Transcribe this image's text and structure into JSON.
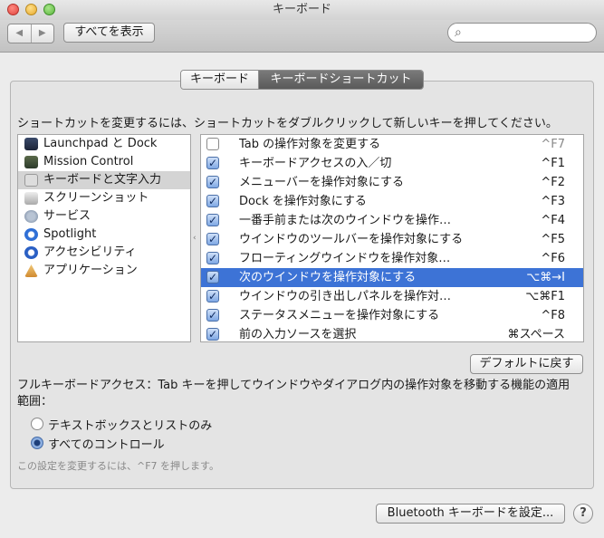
{
  "window": {
    "title": "キーボード"
  },
  "toolbar": {
    "back": "◀",
    "forward": "▶",
    "show_all": "すべてを表示",
    "search_icon": "🔍"
  },
  "tabs": [
    {
      "label": "キーボード",
      "selected": false
    },
    {
      "label": "キーボードショートカット",
      "selected": true
    }
  ],
  "instruction": "ショートカットを変更するには、ショートカットをダブルクリックして新しいキーを押してください。",
  "categories": [
    {
      "label": "Launchpad と Dock",
      "icon": "launchpad-dock-icon",
      "selected": false
    },
    {
      "label": "Mission Control",
      "icon": "mission-control-icon",
      "selected": false
    },
    {
      "label": "キーボードと文字入力",
      "icon": "keyboard-icon",
      "selected": true
    },
    {
      "label": "スクリーンショット",
      "icon": "screenshot-icon",
      "selected": false
    },
    {
      "label": "サービス",
      "icon": "gear-icon",
      "selected": false
    },
    {
      "label": "Spotlight",
      "icon": "spotlight-icon",
      "selected": false
    },
    {
      "label": "アクセシビリティ",
      "icon": "accessibility-icon",
      "selected": false
    },
    {
      "label": "アプリケーション",
      "icon": "app-store-icon",
      "selected": false
    }
  ],
  "shortcuts": [
    {
      "label": "Tab の操作対象を変更する",
      "key": "^F7",
      "checked": false,
      "selected": false
    },
    {
      "label": "キーボードアクセスの入／切",
      "key": "^F1",
      "checked": true,
      "selected": false
    },
    {
      "label": "メニューバーを操作対象にする",
      "key": "^F2",
      "checked": true,
      "selected": false
    },
    {
      "label": "Dock を操作対象にする",
      "key": "^F3",
      "checked": true,
      "selected": false
    },
    {
      "label": "一番手前または次のウインドウを操作…",
      "key": "^F4",
      "checked": true,
      "selected": false
    },
    {
      "label": "ウインドウのツールバーを操作対象にする",
      "key": "^F5",
      "checked": true,
      "selected": false
    },
    {
      "label": "フローティングウインドウを操作対象…",
      "key": "^F6",
      "checked": true,
      "selected": false
    },
    {
      "label": "次のウインドウを操作対象にする",
      "key": "⌥⌘→I",
      "checked": true,
      "selected": true
    },
    {
      "label": "ウインドウの引き出しパネルを操作対…",
      "key": "⌥⌘F1",
      "checked": true,
      "selected": false
    },
    {
      "label": "ステータスメニューを操作対象にする",
      "key": "^F8",
      "checked": true,
      "selected": false
    },
    {
      "label": "前の入力ソースを選択",
      "key": "⌘スペース",
      "checked": true,
      "selected": false
    }
  ],
  "defaults_button": "デフォルトに戻す",
  "full_keyboard_access": {
    "description": "フルキーボードアクセス：Tab キーを押してウインドウやダイアログ内の操作対象を移動する機能の適用範囲：",
    "options": [
      {
        "label": "テキストボックスとリストのみ",
        "selected": false
      },
      {
        "label": "すべてのコントロール",
        "selected": true
      }
    ],
    "hint": "この設定を変更するには、^F7 を押します。"
  },
  "bluetooth_button": "Bluetooth キーボードを設定...",
  "help_button": "?"
}
